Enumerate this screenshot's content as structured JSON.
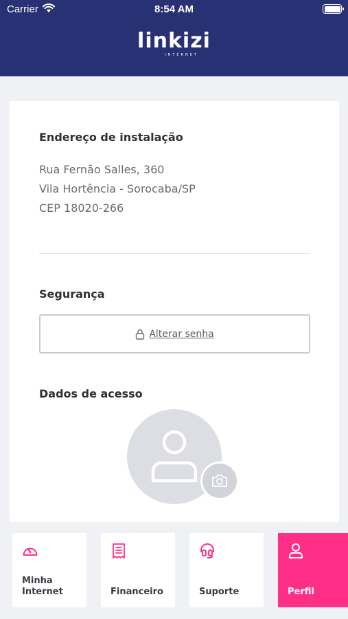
{
  "status_bar": {
    "carrier": "Carrier",
    "time": "8:54 AM"
  },
  "header": {
    "logo_main": "linkizi",
    "logo_sub": "INTERNET"
  },
  "address": {
    "title": "Endereço de instalação",
    "lines": [
      "Rua Fernão Salles, 360",
      "Vila Hortência - Sorocaba/SP",
      "CEP 18020-266"
    ]
  },
  "security": {
    "title": "Segurança",
    "change_password_label": "Alterar senha"
  },
  "access": {
    "title": "Dados de acesso"
  },
  "bottom_nav": {
    "items": [
      {
        "label_line1": "Minha",
        "label_line2": "Internet",
        "icon": "speedometer-icon",
        "active": false
      },
      {
        "label": "Financeiro",
        "icon": "receipt-icon",
        "active": false
      },
      {
        "label": "Suporte",
        "icon": "headset-icon",
        "active": false
      },
      {
        "label": "Perfil",
        "icon": "user-icon",
        "active": true
      }
    ]
  },
  "colors": {
    "header_bg": "#283174",
    "accent": "#ff2f87"
  }
}
